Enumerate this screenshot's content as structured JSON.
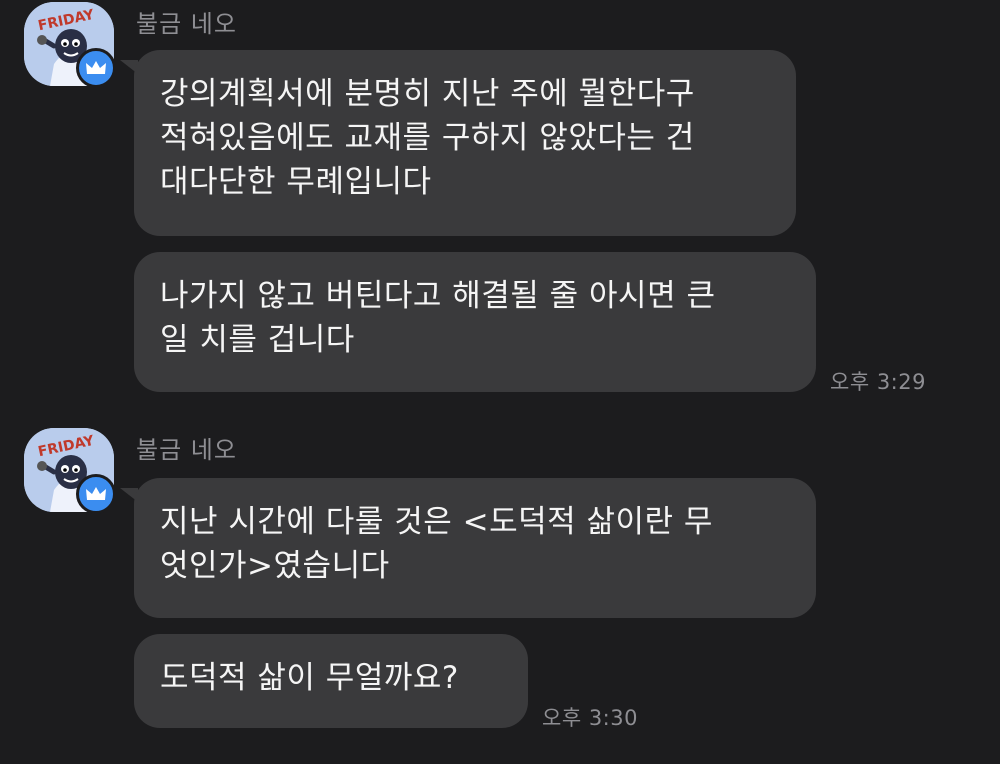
{
  "groups": [
    {
      "sender": "불금 네오",
      "avatar_icon": "friday-character-avatar",
      "badge_icon": "crown-icon",
      "messages": [
        {
          "lines": [
            "강의계획서에 분명히 지난 주에 뭘한다구",
            "적혀있음에도 교재를 구하지 않았다는 건",
            "대다단한 무례입니다"
          ]
        },
        {
          "lines": [
            "나가지 않고 버틴다고 해결될 줄 아시면 큰",
            "일 치를 겁니다"
          ]
        }
      ],
      "time": "오후 3:29"
    },
    {
      "sender": "불금 네오",
      "avatar_icon": "friday-character-avatar",
      "badge_icon": "crown-icon",
      "messages": [
        {
          "lines": [
            "지난 시간에  다룰 것은 <도덕적 삶이란 무",
            "엇인가>였습니다"
          ]
        },
        {
          "lines": [
            "도덕적 삶이 무얼까요?"
          ]
        }
      ],
      "time": "오후 3:30"
    }
  ],
  "avatar_text": "FRIDAY",
  "colors": {
    "background": "#1c1c1e",
    "bubble": "#3a3a3c",
    "badge": "#3b8df0",
    "avatar_bg": "#b9ccec"
  }
}
